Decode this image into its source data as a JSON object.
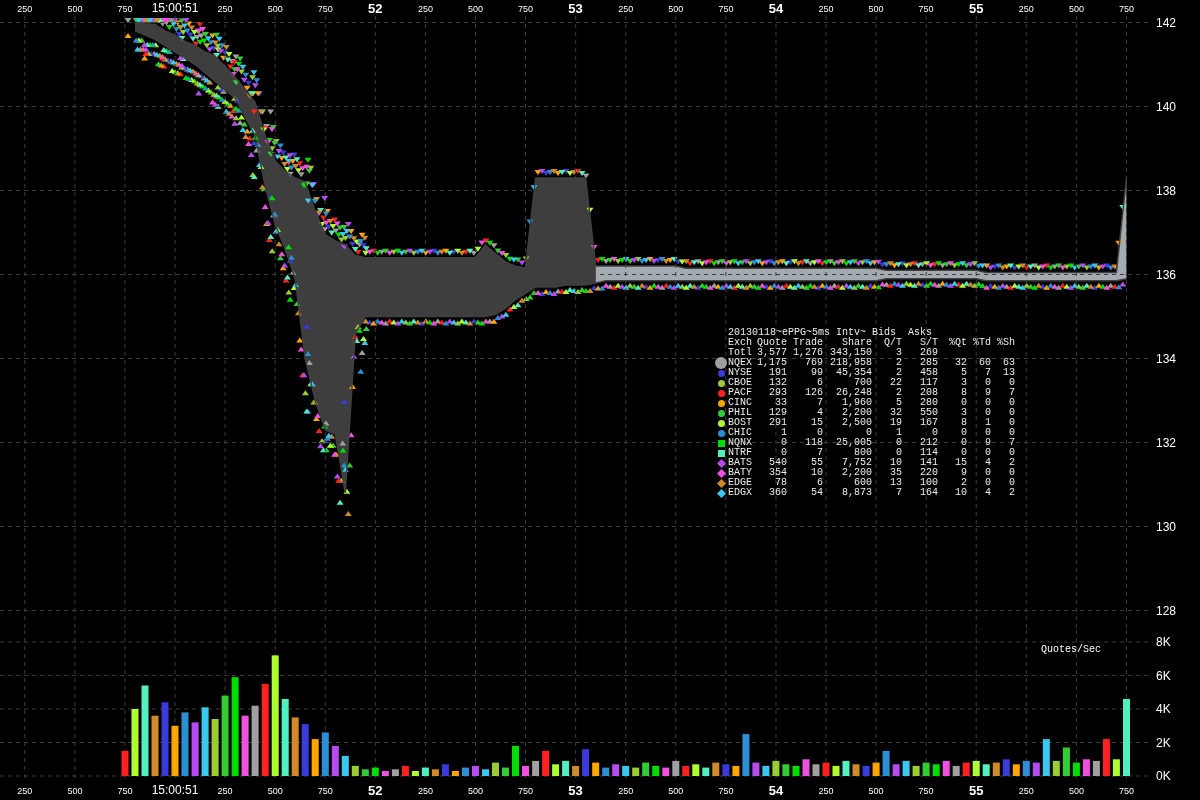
{
  "price_chart": {
    "chart_data": {
      "type": "line",
      "categories": [
        "250",
        null,
        null,
        null,
        null,
        "500",
        null,
        null,
        null,
        null,
        "750",
        null,
        null,
        null,
        null,
        "15:00:51",
        null,
        null,
        null,
        null,
        "250",
        null,
        null,
        null,
        null,
        "500",
        null,
        null,
        null,
        null,
        "750",
        null,
        null,
        null,
        null,
        "52",
        null,
        null,
        null,
        null,
        "250",
        null,
        null,
        null,
        null,
        "500",
        null,
        null,
        null,
        null,
        "750",
        null,
        null,
        null,
        null,
        "53",
        null,
        null,
        null,
        null,
        "250",
        null,
        null,
        null,
        null,
        "500",
        null,
        null,
        null,
        null,
        "750",
        null,
        null,
        null,
        null,
        "54",
        null,
        null,
        null,
        null,
        "250",
        null,
        null,
        null,
        null,
        "500",
        null,
        null,
        null,
        null,
        "750",
        null,
        null,
        null,
        null,
        "55",
        null,
        null,
        null,
        null,
        "250",
        null,
        null,
        null,
        null,
        "500",
        null,
        null,
        null,
        null,
        "750"
      ],
      "series": [
        {
          "color": "#404040",
          "values": [
            null,
            null,
            null,
            null,
            null,
            null,
            null,
            null,
            null,
            null,
            null,
            142.0,
            141.97,
            141.95,
            141.8,
            141.7,
            141.55,
            141.45,
            141.3,
            141.2,
            140.95,
            140.7,
            140.4,
            140.1,
            139.3,
            138.7,
            138.45,
            138.3,
            138.2,
            137.5,
            136.95,
            136.8,
            136.7,
            136.45,
            136.4,
            136.4,
            136.4,
            136.4,
            136.4,
            136.4,
            136.4,
            136.4,
            136.4,
            136.4,
            136.4,
            136.4,
            136.7,
            136.5,
            136.3,
            136.2,
            136.15,
            138.3,
            138.3,
            138.3,
            138.3,
            138.3,
            138.3,
            136.2,
            136.2,
            136.2,
            136.2,
            136.2,
            136.2,
            136.2,
            136.2,
            136.2,
            136.15,
            136.15,
            136.15,
            136.15,
            136.15,
            136.15,
            136.15,
            136.15,
            136.15,
            136.15,
            136.15,
            136.15,
            136.15,
            136.15,
            136.15,
            136.15,
            136.15,
            136.15,
            136.15,
            136.15,
            136.1,
            136.1,
            136.1,
            136.1,
            136.1,
            136.1,
            136.1,
            136.1,
            136.1,
            136.1,
            136.05,
            136.05,
            136.05,
            136.05,
            136.05,
            136.05,
            136.05,
            136.05,
            136.05,
            136.05,
            136.05,
            136.05,
            136.05,
            136.05,
            138.3
          ]
        },
        {
          "color": "#404040",
          "values": [
            null,
            null,
            null,
            null,
            null,
            null,
            null,
            null,
            null,
            null,
            null,
            141.8,
            141.7,
            141.6,
            141.45,
            141.3,
            141.15,
            141.0,
            140.8,
            140.6,
            140.4,
            140.2,
            139.75,
            139.3,
            138.1,
            137.2,
            136.6,
            135.9,
            134.0,
            133.0,
            132.3,
            132.2,
            130.8,
            134.6,
            135.0,
            135.0,
            135.0,
            135.0,
            135.0,
            135.0,
            135.0,
            135.0,
            135.0,
            135.0,
            135.0,
            135.0,
            135.0,
            135.05,
            135.2,
            135.4,
            135.55,
            135.7,
            135.7,
            135.7,
            135.75,
            135.75,
            135.75,
            135.8,
            135.85,
            135.85,
            135.85,
            135.85,
            135.85,
            135.85,
            135.85,
            135.85,
            135.85,
            135.85,
            135.85,
            135.85,
            135.85,
            135.85,
            135.85,
            135.85,
            135.85,
            135.85,
            135.85,
            135.85,
            135.85,
            135.85,
            135.85,
            135.85,
            135.85,
            135.85,
            135.85,
            135.85,
            135.9,
            135.9,
            135.9,
            135.9,
            135.9,
            135.9,
            135.9,
            135.9,
            135.9,
            135.9,
            135.85,
            135.85,
            135.85,
            135.85,
            135.85,
            135.85,
            135.85,
            135.85,
            135.85,
            135.85,
            135.85,
            135.85,
            135.85,
            135.85,
            135.9
          ]
        }
      ],
      "ylim": [
        128,
        142
      ],
      "yticks": [
        128,
        130,
        132,
        134,
        136,
        138,
        140,
        142
      ],
      "grid": true
    }
  },
  "legend": {
    "title": "20130118~ePPG~5ms Intv~ Bids  Asks",
    "columns": [
      "Exch",
      "Quote",
      "Trade",
      "Share",
      "Q/T",
      "S/T",
      "%Qt",
      "%Td",
      "%Sh"
    ],
    "rows": [
      {
        "kind": "total",
        "cells": [
          "Totl",
          "3,577",
          "1,276",
          "343,150",
          "3",
          "269"
        ]
      },
      {
        "kind": "large-dot",
        "color": "#a0a0a0",
        "cells": [
          "NQEX",
          "1,175",
          "769",
          "218,958",
          "2",
          "285",
          "32",
          "60",
          "63"
        ]
      },
      {
        "kind": "dot",
        "color": "#3b3bdb",
        "cells": [
          "NYSE",
          "191",
          "99",
          "45,354",
          "2",
          "458",
          "5",
          "7",
          "13"
        ]
      },
      {
        "kind": "dot",
        "color": "#9acd32",
        "cells": [
          "CBOE",
          "132",
          "6",
          "700",
          "22",
          "117",
          "3",
          "0",
          "0"
        ]
      },
      {
        "kind": "dot",
        "color": "#ff2020",
        "cells": [
          "PACF",
          "293",
          "126",
          "26,248",
          "2",
          "208",
          "8",
          "9",
          "7"
        ]
      },
      {
        "kind": "dot",
        "color": "#ffa500",
        "cells": [
          "CINC",
          "33",
          "7",
          "1,960",
          "5",
          "280",
          "0",
          "0",
          "0"
        ]
      },
      {
        "kind": "dot",
        "color": "#32cd32",
        "cells": [
          "PHIL",
          "129",
          "4",
          "2,200",
          "32",
          "550",
          "3",
          "0",
          "0"
        ]
      },
      {
        "kind": "dot",
        "color": "#adff2f",
        "cells": [
          "BOST",
          "291",
          "15",
          "2,500",
          "19",
          "167",
          "8",
          "1",
          "0"
        ]
      },
      {
        "kind": "dot",
        "color": "#2b8fd6",
        "cells": [
          "CHIC",
          "1",
          "0",
          "0",
          "1",
          "0",
          "0",
          "0",
          "0"
        ]
      },
      {
        "kind": "square",
        "color": "#00dd00",
        "cells": [
          "NQNX",
          "0",
          "118",
          "25,005",
          "0",
          "212",
          "0",
          "9",
          "7"
        ]
      },
      {
        "kind": "square",
        "color": "#50f0c0",
        "cells": [
          "NTRF",
          "0",
          "7",
          "800",
          "0",
          "114",
          "0",
          "0",
          "0"
        ]
      },
      {
        "kind": "diamond",
        "color": "#b44cf0",
        "cells": [
          "BATS",
          "540",
          "55",
          "7,752",
          "10",
          "141",
          "15",
          "4",
          "2"
        ]
      },
      {
        "kind": "diamond",
        "color": "#f050e0",
        "cells": [
          "BATY",
          "354",
          "10",
          "2,200",
          "35",
          "220",
          "9",
          "0",
          "0"
        ]
      },
      {
        "kind": "diamond",
        "color": "#d08a2a",
        "cells": [
          "EDGE",
          "78",
          "6",
          "600",
          "13",
          "100",
          "2",
          "0",
          "0"
        ]
      },
      {
        "kind": "diamond",
        "color": "#38c8f0",
        "cells": [
          "EDGX",
          "360",
          "54",
          "8,873",
          "7",
          "164",
          "10",
          "4",
          "2"
        ]
      }
    ]
  },
  "volume_chart": {
    "chart_data": {
      "type": "bar",
      "title": "Quotes/Sec",
      "categories": [
        "250",
        null,
        null,
        null,
        null,
        "500",
        null,
        null,
        null,
        null,
        "750",
        null,
        null,
        null,
        null,
        "15:00:51",
        null,
        null,
        null,
        null,
        "250",
        null,
        null,
        null,
        null,
        "500",
        null,
        null,
        null,
        null,
        "750",
        null,
        null,
        null,
        null,
        "52",
        null,
        null,
        null,
        null,
        "250",
        null,
        null,
        null,
        null,
        "500",
        null,
        null,
        null,
        null,
        "750",
        null,
        null,
        null,
        null,
        "53",
        null,
        null,
        null,
        null,
        "250",
        null,
        null,
        null,
        null,
        "500",
        null,
        null,
        null,
        null,
        "750",
        null,
        null,
        null,
        null,
        "54",
        null,
        null,
        null,
        null,
        "250",
        null,
        null,
        null,
        null,
        "500",
        null,
        null,
        null,
        null,
        "750",
        null,
        null,
        null,
        null,
        "55",
        null,
        null,
        null,
        null,
        "250",
        null,
        null,
        null,
        null,
        "500",
        null,
        null,
        null,
        null,
        "750"
      ],
      "series": [
        {
          "values": [
            null,
            null,
            null,
            null,
            null,
            null,
            null,
            null,
            null,
            null,
            1.5,
            4.0,
            5.4,
            3.6,
            4.4,
            3.0,
            3.8,
            3.2,
            4.1,
            3.4,
            4.8,
            5.9,
            3.6,
            4.2,
            5.5,
            7.2,
            4.6,
            3.5,
            3.1,
            2.2,
            2.6,
            1.8,
            1.2,
            0.6,
            0.4,
            0.5,
            0.3,
            0.4,
            0.6,
            0.3,
            0.5,
            0.4,
            0.7,
            0.3,
            0.5,
            0.6,
            0.4,
            0.8,
            0.5,
            1.8,
            0.6,
            0.9,
            1.5,
            0.7,
            0.9,
            0.6,
            1.6,
            0.8,
            0.5,
            0.7,
            0.6,
            0.5,
            0.8,
            0.6,
            0.5,
            0.9,
            0.6,
            0.7,
            0.5,
            0.8,
            0.7,
            0.6,
            2.5,
            0.8,
            0.6,
            0.9,
            0.7,
            0.6,
            1.0,
            0.7,
            0.8,
            0.6,
            0.9,
            0.7,
            0.6,
            0.8,
            1.5,
            0.7,
            0.9,
            0.6,
            0.8,
            0.7,
            0.9,
            0.6,
            0.8,
            0.9,
            0.7,
            0.8,
            1.0,
            0.7,
            0.9,
            0.8,
            2.2,
            0.9,
            1.7,
            0.8,
            1.0,
            0.9,
            2.2,
            1.0,
            4.6
          ]
        }
      ],
      "ylim": [
        0,
        8
      ],
      "yticks": [
        {
          "value": 0,
          "label": "0K"
        },
        {
          "value": 2,
          "label": "2K"
        },
        {
          "value": 4,
          "label": "4K"
        },
        {
          "value": 6,
          "label": "6K"
        },
        {
          "value": 8,
          "label": "8K"
        }
      ],
      "grid": true
    }
  }
}
